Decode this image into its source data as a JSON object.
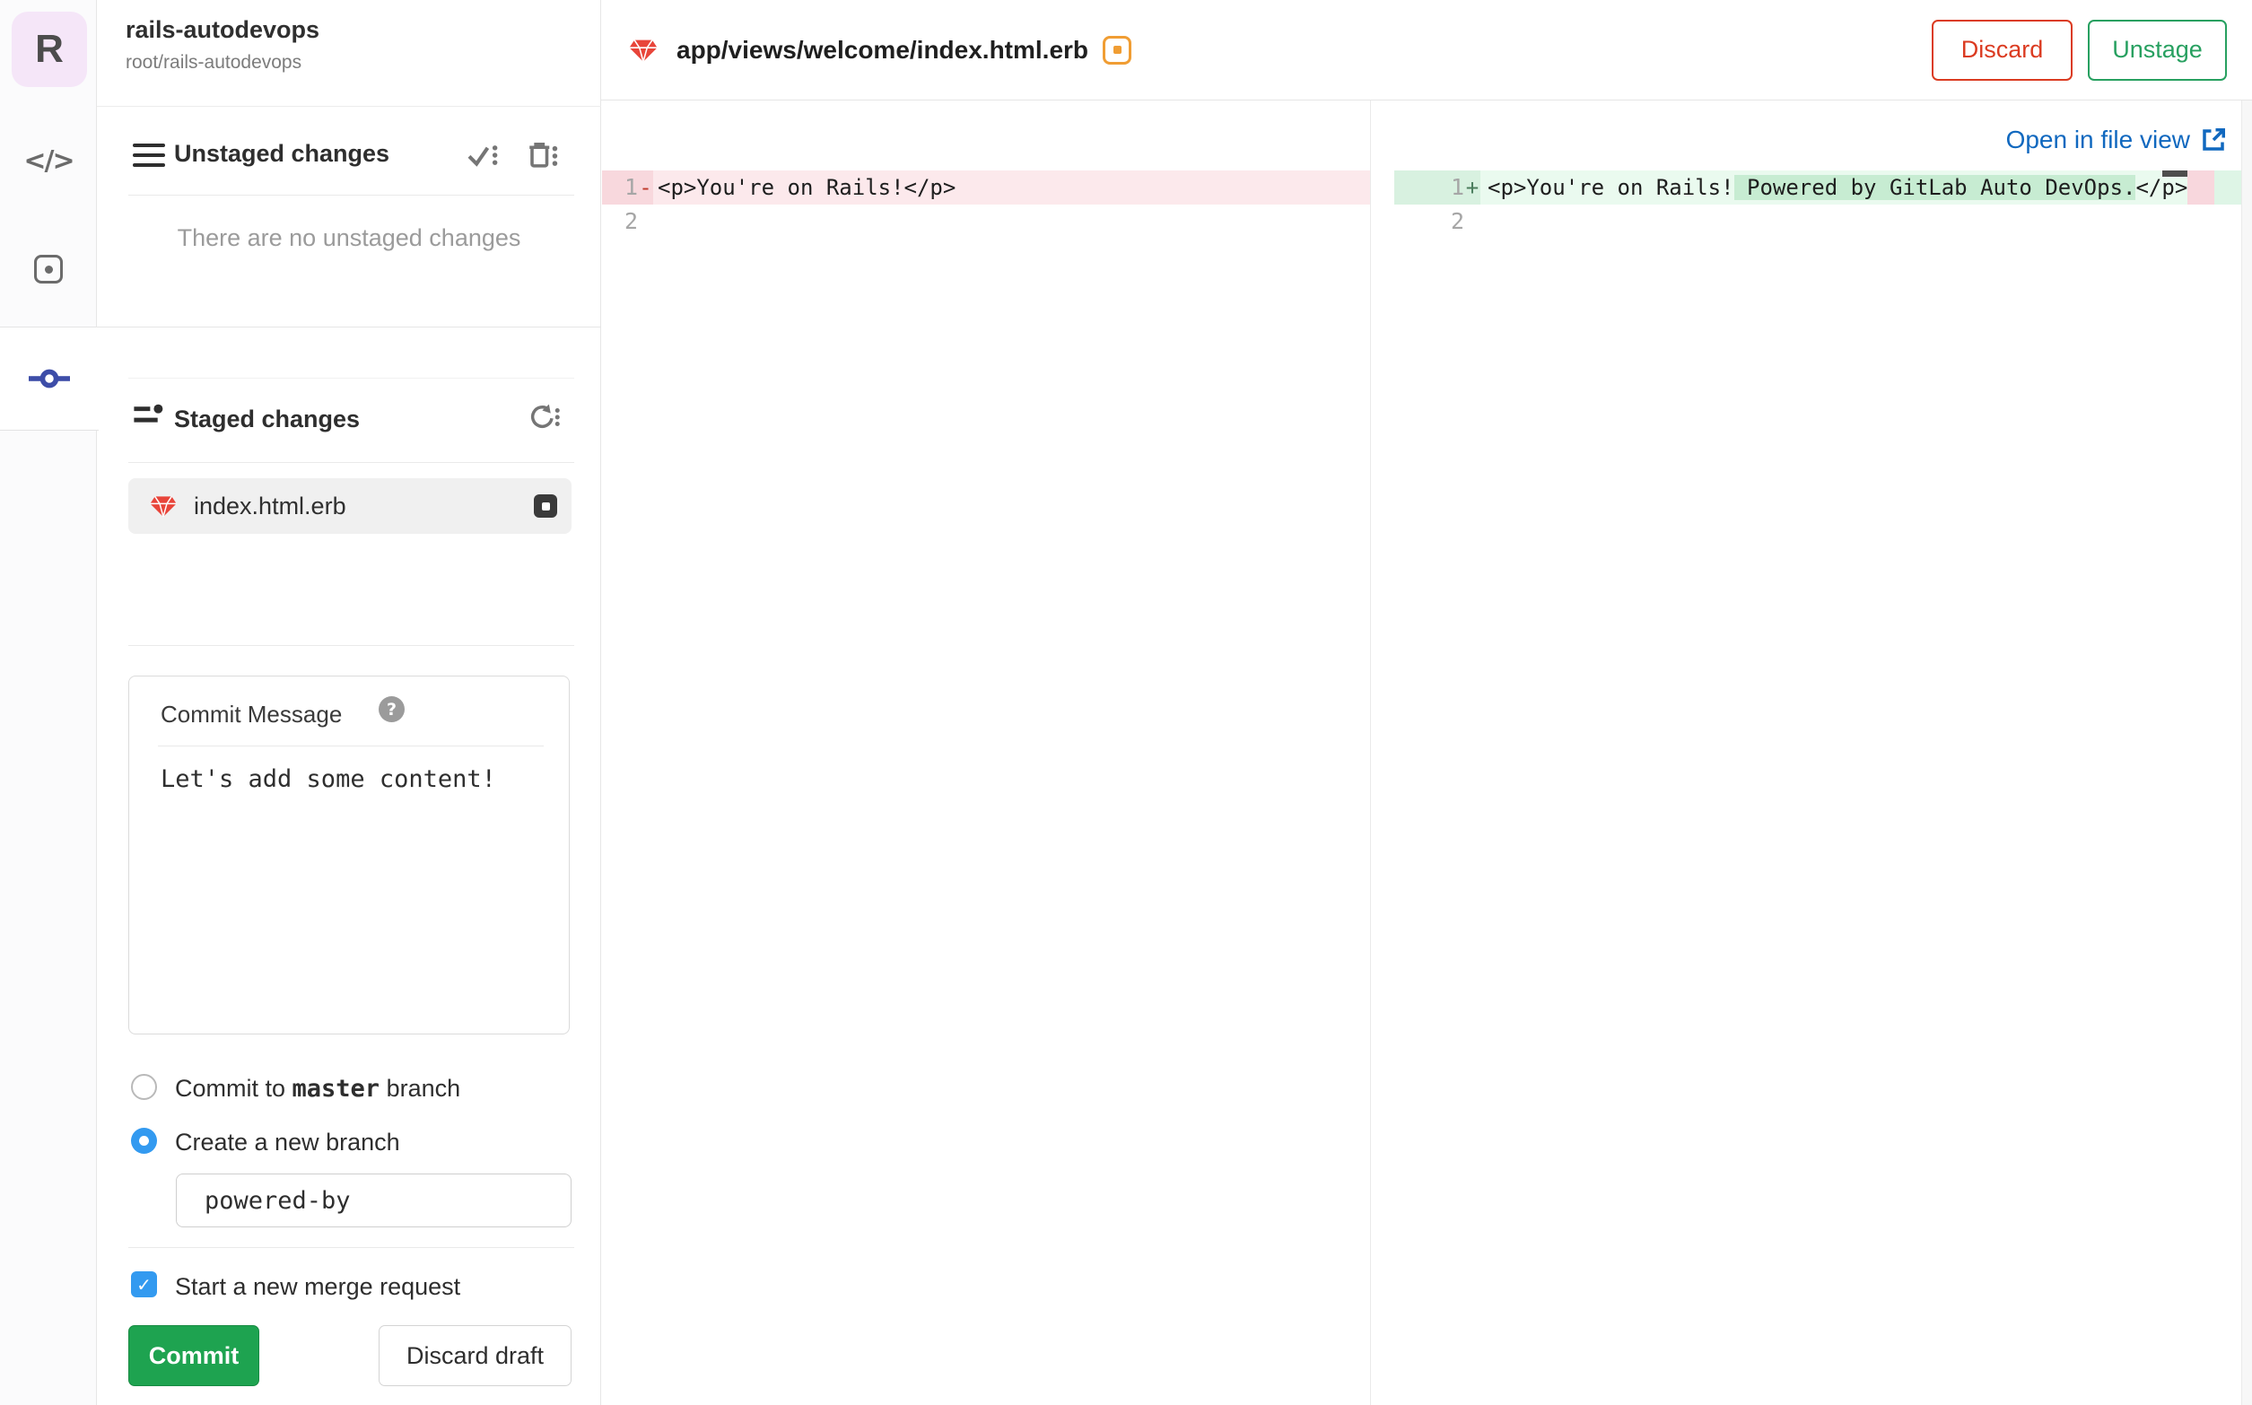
{
  "project": {
    "avatar_letter": "R",
    "name": "rails-autodevops",
    "path": "root/rails-autodevops"
  },
  "rail": {
    "code_glyph": "</>",
    "active_item": "commit"
  },
  "unstaged": {
    "title": "Unstaged changes",
    "empty_message": "There are no unstaged changes"
  },
  "staged": {
    "title": "Staged changes",
    "file_name": "index.html.erb"
  },
  "commit_form": {
    "message_label": "Commit Message",
    "help_glyph": "?",
    "message_value": "Let's add some content!",
    "radio_master_pre": "Commit to ",
    "radio_master_branch": "master",
    "radio_master_post": " branch",
    "radio_new_branch": "Create a new branch",
    "branch_input_value": "powered-by",
    "checkbox_glyph": "✓",
    "checkbox_label": "Start a new merge request",
    "commit_button": "Commit",
    "discard_button": "Discard draft"
  },
  "editor": {
    "file_path": "app/views/welcome/index.html.erb",
    "discard_button": "Discard",
    "unstage_button": "Unstage",
    "open_link": "Open in file view"
  },
  "diff": {
    "left": {
      "rows": [
        {
          "num": "1",
          "sign": "-",
          "text": "<p>You're on Rails!</p>"
        },
        {
          "num": "2",
          "sign": "",
          "text": ""
        }
      ]
    },
    "right": {
      "rows": [
        {
          "num": "1",
          "sign": "+",
          "pre": "<p>You're on Rails!",
          "added": " Powered by GitLab Auto DevOps.",
          "post": "</p>"
        },
        {
          "num": "2",
          "sign": "",
          "pre": "",
          "added": "",
          "post": ""
        }
      ]
    }
  },
  "colors": {
    "commit_green": "#1ea350",
    "discard_red": "#db3b21",
    "unstage_green": "#27a060",
    "link_blue": "#1068bf",
    "control_blue": "#339af0",
    "rail_active_indigo": "#3d4da8",
    "removed_bg": "#fce9ec",
    "removed_gutter_bg": "#f8d8dd",
    "added_bg": "#eafaef",
    "added_gutter_bg": "#d8f1e0",
    "added_highlight_bg": "#c7ecd2",
    "ruby_red": "#e8453a",
    "modified_orange": "#f09d33"
  }
}
